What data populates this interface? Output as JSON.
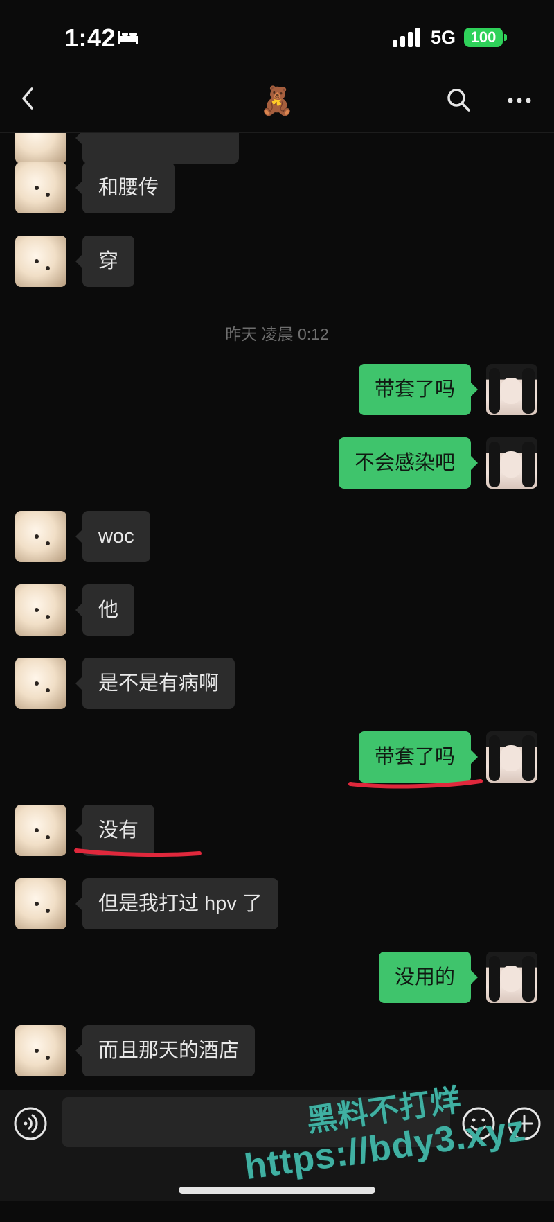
{
  "status_bar": {
    "time": "1:42",
    "network": "5G",
    "battery": "100"
  },
  "nav": {
    "title": "🧸",
    "back_icon": "chevron-left-icon",
    "search_icon": "search-icon",
    "more_icon": "more-icon"
  },
  "messages": [
    {
      "from": "them",
      "text": "和腰传"
    },
    {
      "from": "them",
      "text": "穿"
    },
    {
      "type": "timestamp",
      "text": "昨天 凌晨 0:12"
    },
    {
      "from": "me",
      "text": "带套了吗"
    },
    {
      "from": "me",
      "text": "不会感染吧"
    },
    {
      "from": "them",
      "text": "woc"
    },
    {
      "from": "them",
      "text": "他"
    },
    {
      "from": "them",
      "text": "是不是有病啊"
    },
    {
      "from": "me",
      "text": "带套了吗",
      "underlined": true
    },
    {
      "from": "them",
      "text": "没有",
      "underlined": true
    },
    {
      "from": "them",
      "text": "但是我打过 hpv 了"
    },
    {
      "from": "me",
      "text": "没用的"
    },
    {
      "from": "them",
      "text": "而且那天的酒店"
    }
  ],
  "input_bar": {
    "placeholder": "",
    "voice_icon": "voice-icon",
    "emoji_icon": "emoji-icon",
    "plus_icon": "plus-icon"
  },
  "watermark": {
    "line1": "黑料不打烊",
    "line2": "https://bdy3.xyz"
  },
  "colors": {
    "background": "#0b0b0b",
    "bubble_me": "#3fc46c",
    "bubble_them": "#2c2c2c",
    "underline": "#e0283c",
    "watermark": "#40b0a2"
  }
}
